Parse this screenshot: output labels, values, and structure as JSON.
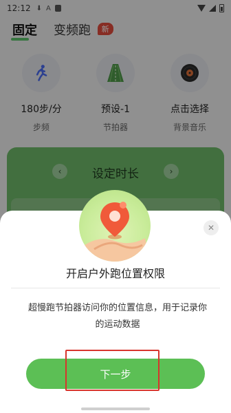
{
  "status_bar": {
    "time": "12:12"
  },
  "tabs": [
    {
      "label": "固定",
      "active": true
    },
    {
      "label": "变频跑",
      "active": false,
      "badge": "新"
    }
  ],
  "features": [
    {
      "value": "180步/分",
      "label": "步频",
      "icon": "running-person-icon"
    },
    {
      "value": "预设-1",
      "label": "节拍器",
      "icon": "track-icon"
    },
    {
      "value": "点击选择",
      "label": "背景音乐",
      "icon": "vinyl-record-icon"
    }
  ],
  "card": {
    "title": "设定时长"
  },
  "dialog": {
    "title": "开启户外跑位置权限",
    "description": "超慢跑节拍器访问你的位置信息，用于记录你的运动数据",
    "button_label": "下一步"
  },
  "colors": {
    "accent_green": "#5cbf55",
    "card_green": "#6fb96a",
    "badge_red": "#e14b3c",
    "highlight_red": "#d8342c"
  }
}
